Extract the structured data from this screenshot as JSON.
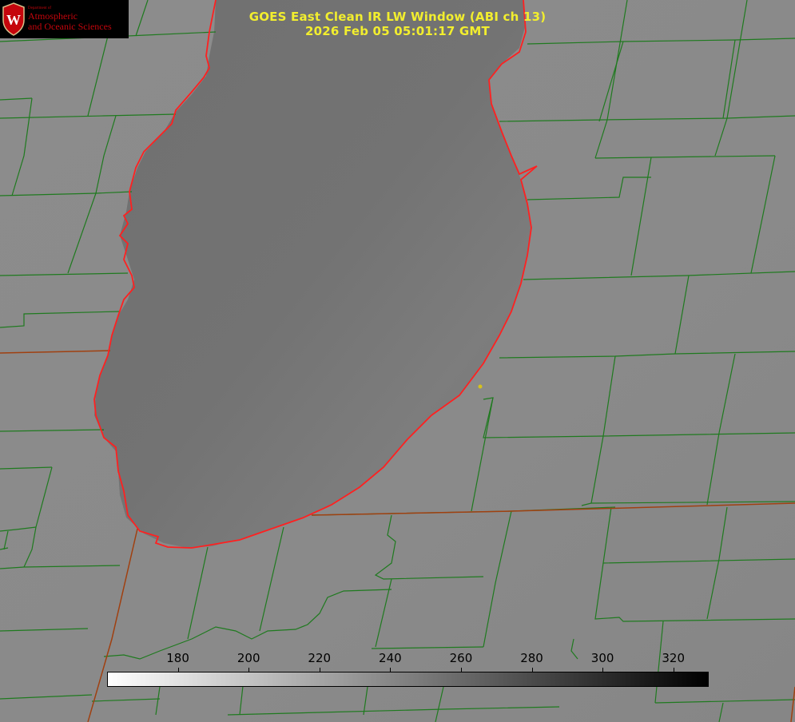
{
  "title": {
    "line1": "GOES East Clean IR LW Window (ABI ch 13)",
    "line2": "2026 Feb 05 05:01:17 GMT"
  },
  "logo": {
    "dept": "Department of",
    "line1": "Atmospheric",
    "line2": "and Oceanic Sciences",
    "icon": "uw-crest-icon"
  },
  "colorbar": {
    "units_min": 160,
    "units_max": 330,
    "ticks": [
      {
        "value": 180,
        "label": "180"
      },
      {
        "value": 200,
        "label": "200"
      },
      {
        "value": 220,
        "label": "220"
      },
      {
        "value": 240,
        "label": "240"
      },
      {
        "value": 260,
        "label": "260"
      },
      {
        "value": 280,
        "label": "280"
      },
      {
        "value": 300,
        "label": "300"
      },
      {
        "value": 320,
        "label": "320"
      }
    ],
    "color_low": "#ffffff",
    "color_high": "#000000"
  },
  "colors": {
    "land": "#8a8a8a",
    "lake": "#7a7a7a",
    "county_lines": "#1f7a1f",
    "state_lines": "#a04010",
    "coastline": "#ff2020",
    "title": "#f2ee2e",
    "marker": "#d6c21c"
  }
}
